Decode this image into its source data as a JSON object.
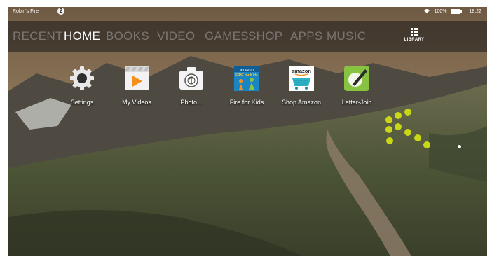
{
  "status": {
    "owner": "Robin's Fire",
    "notification_count": "2",
    "battery": "100%",
    "time": "18:22"
  },
  "nav": {
    "tabs": [
      "RECENT",
      "HOME",
      "BOOKS",
      "VIDEO",
      "GAMES",
      "SHOP",
      "APPS",
      "MUSIC"
    ],
    "active": "HOME",
    "library_label": "LIBRARY"
  },
  "apps": [
    {
      "label": "Settings",
      "icon": "gear-icon"
    },
    {
      "label": "My Videos",
      "icon": "video-icon"
    },
    {
      "label": "Photo...",
      "icon": "camera-icon"
    },
    {
      "label": "Fire for Kids",
      "icon": "kids-icon"
    },
    {
      "label": "Shop Amazon",
      "icon": "shopping-cart-icon"
    },
    {
      "label": "Letter-Join",
      "icon": "pen-icon"
    }
  ],
  "app_tiles": {
    "kids_logo": "amazon",
    "kids_text": "FIRE for Kids",
    "shop_logo": "amazon"
  },
  "colors": {
    "accent_green": "#c8d817",
    "video_orange": "#f4911e",
    "kids_blue": "#1b84c3",
    "shop_teal": "#2fb3c9",
    "letterjoin_green": "#87c341"
  }
}
